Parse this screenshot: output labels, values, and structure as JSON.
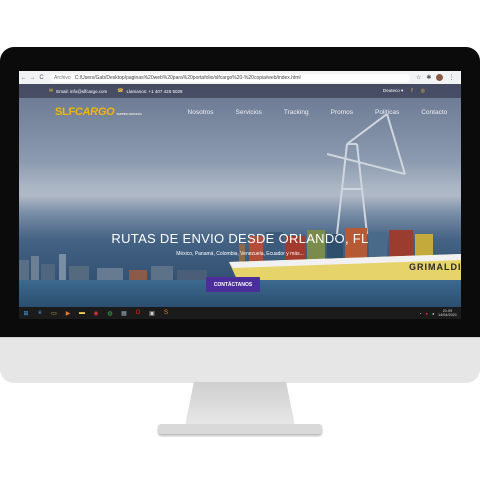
{
  "browser": {
    "url_scheme": "Archivo",
    "url": "C:/Users/Gab/Desktop/paginas%20web%20para%20portafolio/slfcargo%20-%20copia/web/index.html",
    "nav": [
      "←",
      "→",
      "C"
    ]
  },
  "topbar": {
    "email": "Email: info@slfcargo.com",
    "phone": "Llamanos: +1 407 426 5028",
    "lang": "Deuteco",
    "icons": [
      "mail-icon",
      "phone-icon",
      "facebook-icon",
      "instagram-icon"
    ]
  },
  "navbar": {
    "logo_main": "SLF",
    "logo_accent": "CARGO",
    "logo_tagline": "SHIPPING SERVICES",
    "items": [
      "Nosotros",
      "Servicios",
      "Tracking",
      "Promos",
      "Politicas",
      "Contacto"
    ]
  },
  "hero": {
    "title": "RUTAS DE ENVIO DESDE ORLANDO, FL",
    "subtitle": "México, Panamá, Colombia, Venezuela, Ecuador y más...",
    "cta": "CONTÁCTANOS",
    "ship_name": "GRIMALDI"
  },
  "taskbar": {
    "apps": [
      "windows-icon",
      "edge-icon",
      "explorer-icon",
      "media-icon",
      "folder-icon",
      "settings-icon",
      "chrome-icon",
      "store-icon",
      "opera-icon",
      "terminal-icon",
      "sublime-icon"
    ],
    "time": "21:09",
    "date": "14/04/2021"
  },
  "colors": {
    "accent": "#f2b705",
    "cta": "#4b2d9c"
  }
}
